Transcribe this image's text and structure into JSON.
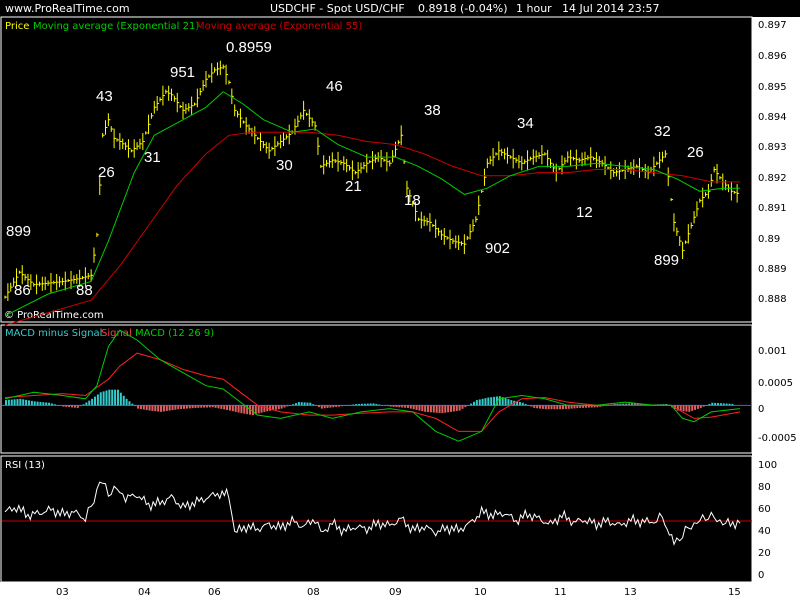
{
  "header": {
    "site": "www.ProRealTime.com",
    "symbol": "USDCHF - Spot USD/CHF",
    "quote": "0.8918 (-0.04%)",
    "timeframe": "1 hour",
    "datetime": "14 Jul 2014 23:57"
  },
  "colors": {
    "bg": "#000000",
    "frame": "#ffffff",
    "axis_bg": "#ffffff",
    "price": "#ffff00",
    "ema21": "#00cc00",
    "ema55": "#cc0000",
    "macd": "#00cc00",
    "signal": "#ff2020",
    "hist_pos": "#33cccc",
    "hist_neg": "#e06060",
    "rsi": "#ffffff",
    "zero_line": "#4060ff"
  },
  "price_panel": {
    "legend": [
      "Price",
      "Moving average (Exponential 21)",
      "Moving average (Exponential 55)"
    ],
    "watermark": "© ProRealTime.com",
    "yticks": [
      "0.897",
      "0.896",
      "0.895",
      "0.894",
      "0.893",
      "0.892",
      "0.891",
      "0.89",
      "0.889",
      "0.888"
    ],
    "labels": [
      "899",
      "86",
      "88",
      "43",
      "26",
      "31",
      "951",
      "0.8959",
      "30",
      "46",
      "21",
      "18",
      "38",
      "902",
      "34",
      "12",
      "32",
      "899",
      "26"
    ]
  },
  "macd_panel": {
    "legend": [
      "MACD minus Signal",
      "Signal",
      "MACD (12 26 9)"
    ],
    "yticks": [
      "0.001",
      "0.0005",
      "0",
      "-0.0005"
    ]
  },
  "rsi_panel": {
    "legend": "RSI (13)",
    "yticks": [
      "100",
      "80",
      "60",
      "40",
      "20",
      "0"
    ],
    "reference_level": 50
  },
  "xaxis": {
    "ticks": [
      "03",
      "04",
      "06",
      "08",
      "09",
      "10",
      "11",
      "13",
      "15"
    ]
  },
  "chart_data": {
    "type": "line",
    "price": {
      "ylim": [
        0.8877,
        0.8975
      ],
      "points": [
        [
          0,
          0.8885
        ],
        [
          0.5,
          0.8893
        ],
        [
          1,
          0.8889
        ],
        [
          2,
          0.889
        ],
        [
          2.6,
          0.8891
        ],
        [
          3.0,
          0.8892
        ],
        [
          3.2,
          0.8905
        ],
        [
          3.4,
          0.8937
        ],
        [
          3.6,
          0.8942
        ],
        [
          3.8,
          0.8936
        ],
        [
          4.0,
          0.8935
        ],
        [
          4.4,
          0.8932
        ],
        [
          4.8,
          0.8935
        ],
        [
          5.2,
          0.8946
        ],
        [
          5.6,
          0.8951
        ],
        [
          5.8,
          0.895
        ],
        [
          6.2,
          0.8945
        ],
        [
          6.6,
          0.8947
        ],
        [
          7.0,
          0.8955
        ],
        [
          7.3,
          0.8958
        ],
        [
          7.6,
          0.8959
        ],
        [
          7.8,
          0.8954
        ],
        [
          8.0,
          0.8945
        ],
        [
          8.4,
          0.894
        ],
        [
          8.8,
          0.8936
        ],
        [
          9.2,
          0.8932
        ],
        [
          9.6,
          0.8935
        ],
        [
          10.0,
          0.8938
        ],
        [
          10.4,
          0.8945
        ],
        [
          10.8,
          0.894
        ],
        [
          11.0,
          0.8927
        ],
        [
          11.4,
          0.8929
        ],
        [
          11.8,
          0.8928
        ],
        [
          12.2,
          0.8925
        ],
        [
          12.6,
          0.8928
        ],
        [
          13.0,
          0.893
        ],
        [
          13.4,
          0.8928
        ],
        [
          13.8,
          0.8937
        ],
        [
          14.0,
          0.892
        ],
        [
          14.4,
          0.891
        ],
        [
          14.8,
          0.8909
        ],
        [
          15.2,
          0.8905
        ],
        [
          15.6,
          0.8903
        ],
        [
          16.0,
          0.8902
        ],
        [
          16.4,
          0.891
        ],
        [
          16.8,
          0.8928
        ],
        [
          17.2,
          0.8932
        ],
        [
          17.6,
          0.893
        ],
        [
          18.0,
          0.8928
        ],
        [
          18.4,
          0.893
        ],
        [
          18.8,
          0.8931
        ],
        [
          19.2,
          0.8925
        ],
        [
          19.6,
          0.893
        ],
        [
          20.0,
          0.8929
        ],
        [
          20.4,
          0.893
        ],
        [
          20.8,
          0.8928
        ],
        [
          21.2,
          0.8925
        ],
        [
          21.6,
          0.8926
        ],
        [
          22.0,
          0.8927
        ],
        [
          22.4,
          0.8925
        ],
        [
          22.8,
          0.8929
        ],
        [
          23.0,
          0.8931
        ],
        [
          23.3,
          0.8909
        ],
        [
          23.6,
          0.89
        ],
        [
          23.9,
          0.8908
        ],
        [
          24.2,
          0.8916
        ],
        [
          24.5,
          0.8919
        ],
        [
          24.7,
          0.8926
        ],
        [
          25.0,
          0.8922
        ],
        [
          25.3,
          0.8919
        ],
        [
          25.6,
          0.8918
        ]
      ]
    },
    "ema21": [
      [
        0,
        0.8879
      ],
      [
        1.5,
        0.8886
      ],
      [
        3.0,
        0.889
      ],
      [
        3.6,
        0.8903
      ],
      [
        4.5,
        0.8925
      ],
      [
        5.2,
        0.8937
      ],
      [
        6.0,
        0.8941
      ],
      [
        7.0,
        0.8946
      ],
      [
        7.6,
        0.8951
      ],
      [
        8.3,
        0.8947
      ],
      [
        9.0,
        0.8942
      ],
      [
        10.0,
        0.8938
      ],
      [
        10.8,
        0.8939
      ],
      [
        11.6,
        0.8934
      ],
      [
        12.6,
        0.893
      ],
      [
        13.6,
        0.893
      ],
      [
        14.4,
        0.8927
      ],
      [
        15.2,
        0.8923
      ],
      [
        16.0,
        0.8918
      ],
      [
        16.8,
        0.892
      ],
      [
        17.6,
        0.8924
      ],
      [
        18.6,
        0.8927
      ],
      [
        19.6,
        0.8927
      ],
      [
        20.6,
        0.8928
      ],
      [
        21.6,
        0.8927
      ],
      [
        22.6,
        0.8926
      ],
      [
        23.4,
        0.8923
      ],
      [
        24.2,
        0.8919
      ],
      [
        25.0,
        0.892
      ],
      [
        25.6,
        0.892
      ]
    ],
    "ema55": [
      [
        0,
        0.8876
      ],
      [
        1.5,
        0.888
      ],
      [
        3.0,
        0.8884
      ],
      [
        4.0,
        0.8895
      ],
      [
        5.0,
        0.8908
      ],
      [
        6.0,
        0.8921
      ],
      [
        7.0,
        0.8931
      ],
      [
        7.8,
        0.8937
      ],
      [
        8.6,
        0.8938
      ],
      [
        9.6,
        0.8938
      ],
      [
        10.6,
        0.8938
      ],
      [
        11.6,
        0.8937
      ],
      [
        12.6,
        0.8935
      ],
      [
        13.6,
        0.8934
      ],
      [
        14.6,
        0.8931
      ],
      [
        15.6,
        0.8927
      ],
      [
        16.6,
        0.8924
      ],
      [
        17.6,
        0.8924
      ],
      [
        18.6,
        0.8925
      ],
      [
        19.6,
        0.8925
      ],
      [
        20.6,
        0.8926
      ],
      [
        21.6,
        0.8926
      ],
      [
        22.6,
        0.8925
      ],
      [
        23.6,
        0.8924
      ],
      [
        24.6,
        0.8922
      ],
      [
        25.6,
        0.8922
      ]
    ],
    "macd": {
      "ylim": [
        -0.00073,
        0.00123
      ],
      "macd": [
        [
          0,
          0.0001
        ],
        [
          1.0,
          0.0002
        ],
        [
          2.0,
          0.00015
        ],
        [
          2.8,
          0.0001
        ],
        [
          3.2,
          0.0003
        ],
        [
          3.6,
          0.0009
        ],
        [
          4.0,
          0.00115
        ],
        [
          4.6,
          0.001
        ],
        [
          5.4,
          0.0007
        ],
        [
          6.2,
          0.0005
        ],
        [
          7.0,
          0.0003
        ],
        [
          7.6,
          0.00025
        ],
        [
          8.2,
          5e-05
        ],
        [
          8.8,
          -0.00015
        ],
        [
          9.6,
          -0.0002
        ],
        [
          10.6,
          -0.0001
        ],
        [
          11.4,
          -0.0002
        ],
        [
          12.4,
          -0.0001
        ],
        [
          13.4,
          -5e-05
        ],
        [
          14.2,
          -0.0001
        ],
        [
          15.0,
          -0.0004
        ],
        [
          15.8,
          -0.00055
        ],
        [
          16.6,
          -0.0004
        ],
        [
          17.2,
          0.0001
        ],
        [
          18.0,
          0.00015
        ],
        [
          18.8,
          0.0001
        ],
        [
          19.6,
          0.0
        ],
        [
          20.6,
          0.0
        ],
        [
          21.6,
          5e-05
        ],
        [
          22.6,
          0.0
        ],
        [
          23.2,
          0.0
        ],
        [
          23.6,
          -0.0002
        ],
        [
          24.0,
          -0.00025
        ],
        [
          24.6,
          -0.0001
        ],
        [
          25.6,
          -5e-05
        ]
      ],
      "signal": [
        [
          0,
          0.00012
        ],
        [
          1.0,
          0.00015
        ],
        [
          2.0,
          0.00018
        ],
        [
          2.8,
          0.00015
        ],
        [
          3.6,
          0.0004
        ],
        [
          4.0,
          0.0006
        ],
        [
          4.6,
          0.0008
        ],
        [
          5.4,
          0.0007
        ],
        [
          6.2,
          0.00055
        ],
        [
          7.0,
          0.00045
        ],
        [
          7.6,
          0.0004
        ],
        [
          8.2,
          0.0002
        ],
        [
          8.8,
          0.0
        ],
        [
          9.6,
          -0.0001
        ],
        [
          10.6,
          -0.00015
        ],
        [
          11.4,
          -0.00015
        ],
        [
          12.4,
          -0.00012
        ],
        [
          13.4,
          -0.0001
        ],
        [
          14.2,
          -0.0001
        ],
        [
          15.0,
          -0.0002
        ],
        [
          15.8,
          -0.0004
        ],
        [
          16.6,
          -0.0004
        ],
        [
          17.2,
          -0.0001
        ],
        [
          18.0,
          0.0001
        ],
        [
          18.8,
          0.00012
        ],
        [
          19.6,
          5e-05
        ],
        [
          20.6,
          0.0
        ],
        [
          21.6,
          0.0
        ],
        [
          22.6,
          0.0
        ],
        [
          23.2,
          0.0
        ],
        [
          23.6,
          -0.0001
        ],
        [
          24.0,
          -0.0002
        ],
        [
          24.6,
          -0.00018
        ],
        [
          25.6,
          -0.0001
        ]
      ],
      "histogram": [
        [
          0,
          8e-05
        ],
        [
          0.5,
          0.0001
        ],
        [
          1,
          6e-05
        ],
        [
          1.5,
          4e-05
        ],
        [
          2,
          -2e-05
        ],
        [
          2.5,
          -4e-05
        ],
        [
          3,
          0.0001
        ],
        [
          3.3,
          0.0002
        ],
        [
          3.6,
          0.00024
        ],
        [
          3.9,
          0.00024
        ],
        [
          4.2,
          0.0001
        ],
        [
          4.6,
          -5e-05
        ],
        [
          5.0,
          -8e-05
        ],
        [
          5.4,
          -0.0001
        ],
        [
          6.0,
          -6e-05
        ],
        [
          6.6,
          -4e-05
        ],
        [
          7.2,
          -3e-05
        ],
        [
          7.8,
          -8e-05
        ],
        [
          8.2,
          -0.00012
        ],
        [
          8.6,
          -0.00015
        ],
        [
          9.0,
          -0.0001
        ],
        [
          9.6,
          -5e-05
        ],
        [
          10.2,
          5e-05
        ],
        [
          10.6,
          4e-05
        ],
        [
          11.0,
          -5e-05
        ],
        [
          11.6,
          -2e-05
        ],
        [
          12.2,
          2e-05
        ],
        [
          12.8,
          3e-05
        ],
        [
          13.4,
          -2e-05
        ],
        [
          14.0,
          -4e-05
        ],
        [
          14.6,
          -0.0001
        ],
        [
          15.2,
          -0.00012
        ],
        [
          15.8,
          -8e-05
        ],
        [
          16.4,
          8e-05
        ],
        [
          16.8,
          0.00012
        ],
        [
          17.2,
          0.00014
        ],
        [
          17.6,
          8e-05
        ],
        [
          18.0,
          4e-05
        ],
        [
          18.4,
          -4e-05
        ],
        [
          18.8,
          -6e-05
        ],
        [
          19.4,
          -6e-05
        ],
        [
          20.0,
          -4e-05
        ],
        [
          20.6,
          -3e-05
        ],
        [
          21.2,
          2e-05
        ],
        [
          21.8,
          3e-05
        ],
        [
          22.4,
          1e-05
        ],
        [
          23.0,
          2e-05
        ],
        [
          23.4,
          -8e-05
        ],
        [
          23.8,
          -0.0001
        ],
        [
          24.2,
          -4e-05
        ],
        [
          24.6,
          4e-05
        ],
        [
          25.0,
          3e-05
        ],
        [
          25.4,
          2e-05
        ]
      ]
    },
    "rsi": {
      "ylim": [
        0,
        100
      ],
      "values": [
        [
          0,
          58
        ],
        [
          0.4,
          62
        ],
        [
          0.8,
          55
        ],
        [
          1.2,
          57
        ],
        [
          1.6,
          60
        ],
        [
          2.0,
          56
        ],
        [
          2.4,
          58
        ],
        [
          2.8,
          52
        ],
        [
          3.1,
          68
        ],
        [
          3.3,
          86
        ],
        [
          3.6,
          75
        ],
        [
          3.9,
          78
        ],
        [
          4.2,
          70
        ],
        [
          4.6,
          73
        ],
        [
          5.0,
          64
        ],
        [
          5.4,
          66
        ],
        [
          5.8,
          71
        ],
        [
          6.2,
          62
        ],
        [
          6.6,
          66
        ],
        [
          7.0,
          70
        ],
        [
          7.4,
          74
        ],
        [
          7.8,
          73
        ],
        [
          8.0,
          40
        ],
        [
          8.4,
          45
        ],
        [
          8.8,
          43
        ],
        [
          9.2,
          47
        ],
        [
          9.6,
          44
        ],
        [
          10.0,
          50
        ],
        [
          10.4,
          45
        ],
        [
          10.8,
          52
        ],
        [
          11.0,
          39
        ],
        [
          11.4,
          48
        ],
        [
          11.8,
          41
        ],
        [
          12.2,
          45
        ],
        [
          12.6,
          43
        ],
        [
          13.0,
          48
        ],
        [
          13.4,
          46
        ],
        [
          13.8,
          52
        ],
        [
          14.2,
          42
        ],
        [
          14.6,
          45
        ],
        [
          15.0,
          40
        ],
        [
          15.4,
          44
        ],
        [
          15.8,
          42
        ],
        [
          16.2,
          48
        ],
        [
          16.6,
          58
        ],
        [
          17.0,
          55
        ],
        [
          17.4,
          57
        ],
        [
          17.8,
          50
        ],
        [
          18.2,
          56
        ],
        [
          18.6,
          52
        ],
        [
          19.0,
          47
        ],
        [
          19.4,
          55
        ],
        [
          19.8,
          49
        ],
        [
          20.2,
          51
        ],
        [
          20.6,
          47
        ],
        [
          21.0,
          50
        ],
        [
          21.4,
          46
        ],
        [
          21.8,
          51
        ],
        [
          22.2,
          49
        ],
        [
          22.6,
          50
        ],
        [
          22.9,
          53
        ],
        [
          23.3,
          30
        ],
        [
          23.6,
          38
        ],
        [
          23.9,
          46
        ],
        [
          24.2,
          50
        ],
        [
          24.5,
          55
        ],
        [
          24.8,
          51
        ],
        [
          25.1,
          48
        ],
        [
          25.6,
          48
        ]
      ]
    }
  }
}
